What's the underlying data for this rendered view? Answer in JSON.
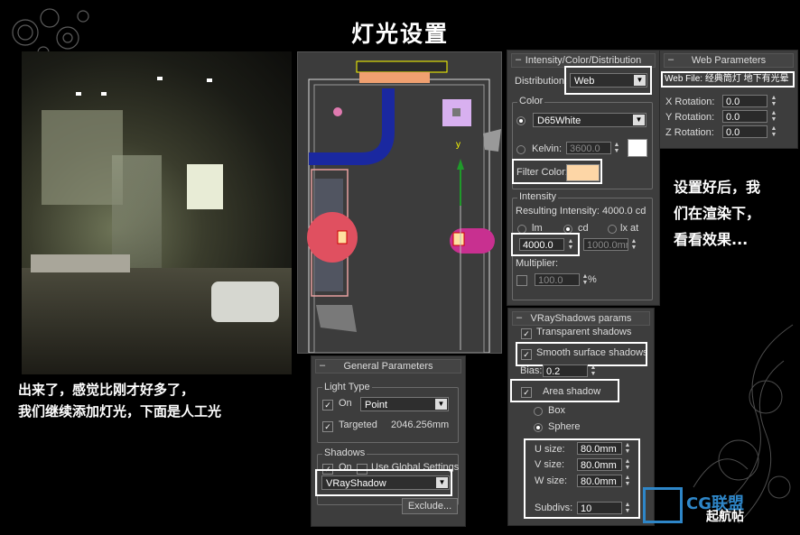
{
  "page": {
    "title": "灯光设置",
    "caption_left": [
      "出来了，感觉比刚才好多了，",
      "我们继续添加灯光，下面是人工光"
    ],
    "caption_right": [
      "设置好后，我",
      "们在渲染下，",
      "看看效果..."
    ],
    "watermark": "CG联盟",
    "watermark_sub": "起航帖"
  },
  "intensity": {
    "header": "Intensity/Color/Distribution",
    "distribution_label": "Distribution:",
    "distribution_value": "Web",
    "color_group": "Color",
    "color_preset": "D65White",
    "kelvin_label": "Kelvin:",
    "kelvin_value": "3600.0",
    "filter_color_label": "Filter Color:",
    "filter_color_hex": "#fdd6a6",
    "intensity_group": "Intensity",
    "resulting_intensity": "Resulting Intensity: 4000.0 cd",
    "unit_lm": "lm",
    "unit_cd": "cd",
    "unit_lx": "lx at",
    "intensity_value": "4000.0",
    "lx_distance": "1000.0mm",
    "multiplier_label": "Multiplier:",
    "multiplier_value": "100.0",
    "percent": "%"
  },
  "web": {
    "header": "Web Parameters",
    "web_file": "Web File: 经典筒灯 地下有光晕",
    "x_label": "X Rotation:",
    "x_value": "0.0",
    "y_label": "Y Rotation:",
    "y_value": "0.0",
    "z_label": "Z Rotation:",
    "z_value": "0.0"
  },
  "general": {
    "header": "General Parameters",
    "light_type_group": "Light Type",
    "on_label": "On",
    "light_type_value": "Point",
    "targeted_label": "Targeted",
    "targeted_distance": "2046.256mm",
    "shadows_group": "Shadows",
    "shadows_on_label": "On",
    "use_global_label": "Use Global Settings",
    "shadow_type": "VRayShadow",
    "exclude_label": "Exclude..."
  },
  "vrayshadows": {
    "header": "VRayShadows params",
    "transparent_label": "Transparent shadows",
    "smooth_label": "Smooth surface shadows",
    "bias_label": "Bias:",
    "bias_value": "0.2",
    "area_label": "Area shadow",
    "box_label": "Box",
    "sphere_label": "Sphere",
    "u_label": "U size:",
    "u_value": "80.0mm",
    "v_label": "V size:",
    "v_value": "80.0mm",
    "w_label": "W size:",
    "w_value": "80.0mm",
    "subdivs_label": "Subdivs:",
    "subdivs_value": "10"
  },
  "viewport": {
    "axis_y": "y"
  }
}
